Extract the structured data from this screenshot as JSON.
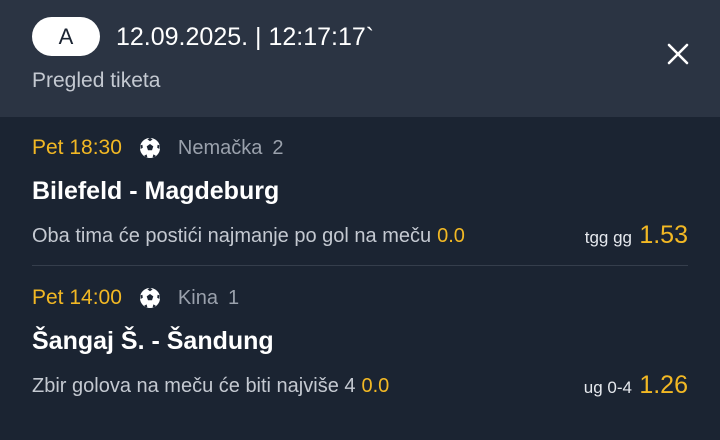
{
  "header": {
    "ticket_type": "A",
    "datetime": "12.09.2025. | 12:17:17`",
    "subtitle": "Pregled tiketa",
    "close_icon": "close-icon"
  },
  "matches": [
    {
      "time": "Pet 18:30",
      "sport_icon": "soccer-ball-icon",
      "league": "Nemačka",
      "league_num": "2",
      "teams": "Bilefeld - Magdeburg",
      "market": "Oba tima će postići najmanje po gol na meču",
      "market_value": "0.0",
      "pick": "tgg gg",
      "odds": "1.53"
    },
    {
      "time": "Pet 14:00",
      "sport_icon": "soccer-ball-icon",
      "league": "Kina",
      "league_num": "1",
      "teams": "Šangaj Š. - Šandung",
      "market": "Zbir golova na meču će biti najviše 4",
      "market_value": "0.0",
      "pick": "ug 0-4",
      "odds": "1.26"
    }
  ],
  "colors": {
    "accent": "#f2b824",
    "background": "#1b2432",
    "header_background": "#2b3443"
  }
}
